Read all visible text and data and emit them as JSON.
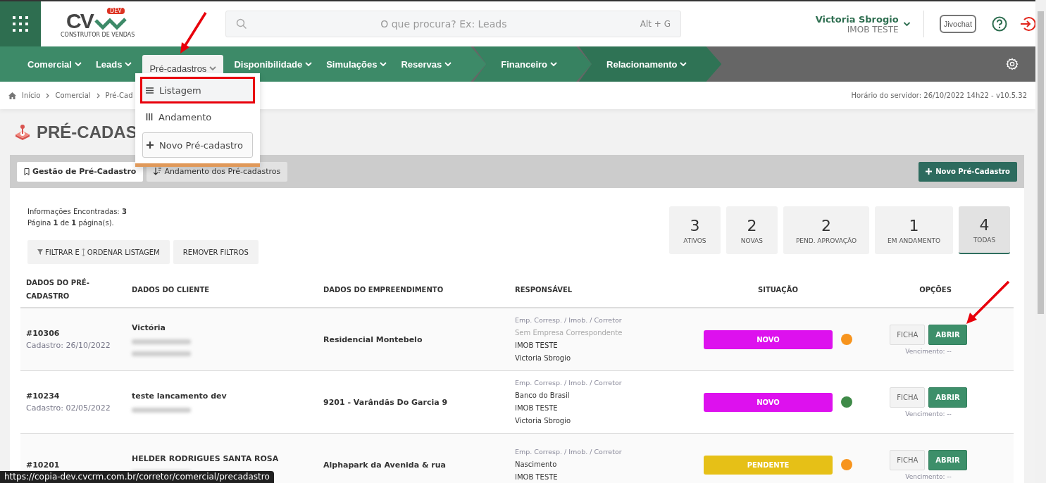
{
  "logo": {
    "letters": "CV",
    "badge": "DEV",
    "tagline": "CONSTRUTOR DE VENDAS"
  },
  "search": {
    "placeholder": "O que procura? Ex: Leads",
    "shortcut": "Alt + G"
  },
  "user": {
    "name": "Victoria Sbrogio",
    "company": "IMOB TESTE"
  },
  "chat_button": "Jivochat",
  "nav": [
    {
      "items": [
        {
          "label": "Comercial",
          "selected": false
        },
        {
          "label": "Leads",
          "selected": false
        },
        {
          "label": "Pré-cadastros",
          "selected": true
        },
        {
          "label": "Disponibilidade",
          "selected": false
        },
        {
          "label": "Simulações",
          "selected": false
        },
        {
          "label": "Reservas",
          "selected": false
        }
      ]
    },
    {
      "items": [
        {
          "label": "Financeiro",
          "selected": false
        }
      ]
    },
    {
      "items": [
        {
          "label": "Relacionamento",
          "selected": false
        }
      ]
    }
  ],
  "dropdown": [
    {
      "kind": "list",
      "label": "Listagem",
      "highlighted": true
    },
    {
      "kind": "bars",
      "label": "Andamento",
      "highlighted": false
    },
    {
      "kind": "plus",
      "label": "Novo Pré-cadastro",
      "highlighted": false
    }
  ],
  "breadcrumb": [
    "Início",
    "Comercial",
    "Pré-Cad"
  ],
  "server_time": "Horário do servidor: 26/10/2022 14h22 - v10.5.32",
  "page_title": "PRÉ-CADAS",
  "tabs": [
    {
      "label": "Gestão de Pré-Cadastro",
      "selected": true
    },
    {
      "label": "Andamento dos Pré-cadastros",
      "selected": false
    }
  ],
  "new_button": "Novo Pré-Cadastro",
  "info": [
    "Informações Encontradas: **3**",
    "Página **1** de **1** página(s)."
  ],
  "filter_buttons": [
    {
      "kind": "filter",
      "label": "FILTRAR E",
      "label2": "ORDENAR LISTAGEM"
    },
    {
      "kind": "plain",
      "label": "REMOVER FILTROS"
    }
  ],
  "stats": [
    {
      "value": "3",
      "label": "ATIVOS",
      "selected": false
    },
    {
      "value": "2",
      "label": "NOVAS",
      "selected": false
    },
    {
      "value": "2",
      "label": "PEND. APROVAÇÃO",
      "selected": false
    },
    {
      "value": "1",
      "label": "EM ANDAMENTO",
      "selected": false
    },
    {
      "value": "4",
      "label": "TODAS",
      "selected": true
    }
  ],
  "table": {
    "columns": [
      "DADOS DO PRÉ-CADASTRO",
      "DADOS DO CLIENTE",
      "DADOS DO EMPREENDIMENTO",
      "RESPONSÁVEL",
      "SITUAÇÃO",
      "OPÇÕES"
    ],
    "rows": [
      {
        "id": "#10306",
        "date": "Cadastro: 26/10/2022",
        "client": "Victória",
        "hidden_lines": [
          {
            "kind": "blurred"
          },
          {
            "kind": "blurred"
          }
        ],
        "project": "Residencial Montebelo",
        "resp_label": "Emp. Corresp. / Imob. / Corretor",
        "resp": [
          {
            "text": "Sem Empresa Correspondente",
            "muted": true
          },
          {
            "text": "IMOB TESTE",
            "muted": false
          },
          {
            "text": "Victoria Sbrogio",
            "muted": false
          }
        ],
        "status": {
          "label": "NOVO",
          "color": "#dd11ee"
        },
        "color": "#f7941d",
        "buttons": [
          "FICHA",
          "ABRIR"
        ],
        "due": "Vencimento: --"
      },
      {
        "id": "#10234",
        "date": "Cadastro: 02/05/2022",
        "client": "teste lancamento dev",
        "hidden_lines": [
          {
            "kind": "blurred"
          }
        ],
        "project": "9201 - Varândãs Do Garcia 9",
        "resp_label": "Emp. Corresp. / Imob. / Corretor",
        "resp": [
          {
            "text": "Banco do Brasil",
            "muted": false
          },
          {
            "text": "IMOB TESTE",
            "muted": false
          },
          {
            "text": "Victoria Sbrogio",
            "muted": false
          }
        ],
        "status": {
          "label": "NOVO",
          "color": "#dd11ee"
        },
        "color": "#3f8a48",
        "buttons": [
          "FICHA",
          "ABRIR"
        ],
        "due": "Vencimento: --"
      },
      {
        "id": "#10201",
        "client": "HELDER RODRIGUES SANTA ROSA",
        "hidden_lines": [
          {
            "kind": "blurred"
          }
        ],
        "project": "Alphapark da Avenida & rua",
        "resp_label": "Emp. Corresp. / Imob. / Corretor",
        "resp": [
          {
            "text": "Nascimento",
            "muted": false
          },
          {
            "text": "IMOB TESTE",
            "muted": false
          }
        ],
        "status": {
          "label": "PENDENTE",
          "color": "#e6c017"
        },
        "color": "#f7941d",
        "buttons": [
          "FICHA",
          "ABRIR"
        ],
        "due": "Vencimento: --"
      }
    ]
  },
  "status_url": "https://copia-dev.cvcrm.com.br/corretor/comercial/precadastro"
}
